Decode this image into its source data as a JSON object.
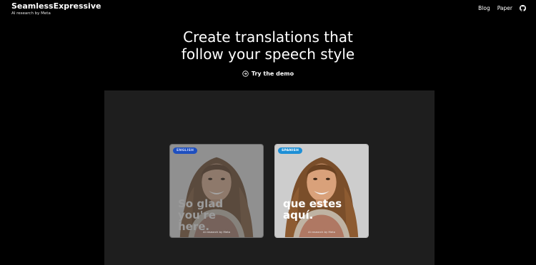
{
  "header": {
    "brand_title": "SeamlessExpressive",
    "brand_subtitle": "AI research by Meta",
    "nav_items": [
      "Blog",
      "Paper"
    ],
    "github_icon": "github-icon"
  },
  "hero": {
    "headline_line1": "Create translations that",
    "headline_line2": "follow your speech style",
    "cta_label": "Try the demo",
    "cta_icon": "arrow-circle-right-icon"
  },
  "cards": [
    {
      "language": "ENGLISH",
      "caption_line1": "So glad you're",
      "caption_line2": "here.",
      "watermark": "AI research by Meta",
      "badge_color": "#1e4fbf"
    },
    {
      "language": "SPANISH",
      "caption_line1": "que estes",
      "caption_line2": "aquí.",
      "watermark": "AI research by Meta",
      "badge_color": "#1d8fd6"
    }
  ],
  "colors": {
    "background": "#000000",
    "stage": "#1e1e1e",
    "text": "#ffffff"
  }
}
